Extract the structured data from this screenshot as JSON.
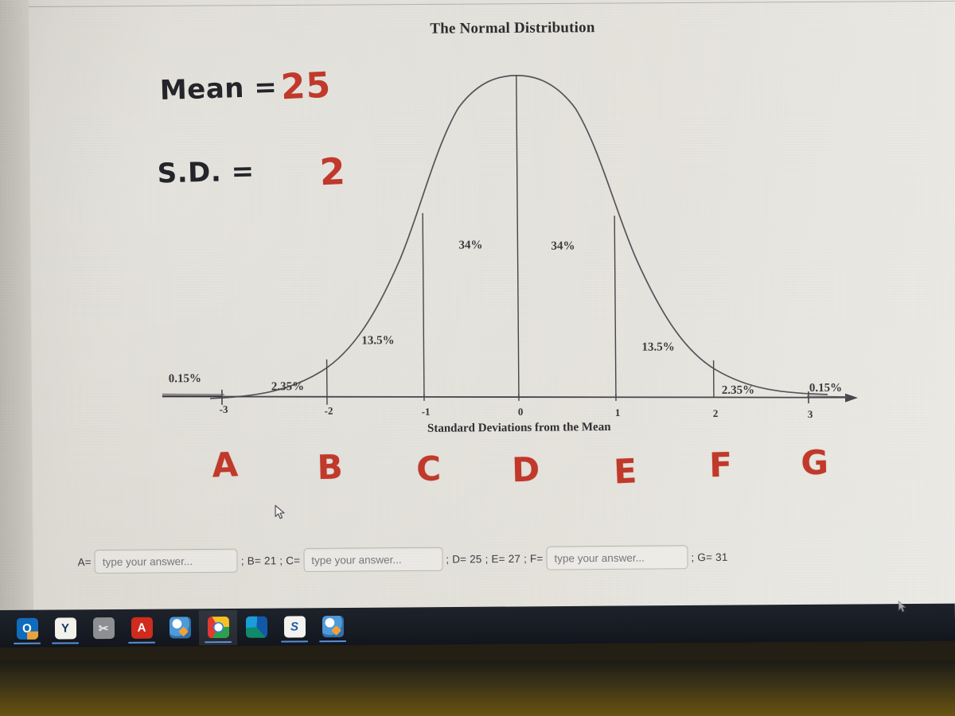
{
  "document": {
    "title": "The Normal Distribution"
  },
  "annotations": {
    "mean_label": "Mean =",
    "mean_value": "25",
    "sd_label": "S.D. =",
    "sd_value": "2",
    "ink_black": "#24252a",
    "ink_red": "#c0392b"
  },
  "chart_data": {
    "type": "area",
    "title": "The Normal Distribution",
    "xlabel": "Standard Deviations from the Mean",
    "ylabel": "",
    "xlim": [
      -3.5,
      3.5
    ],
    "grid": false,
    "legend": "none",
    "x_ticks": [
      "-3",
      "-2",
      "-1",
      "0",
      "1",
      "2",
      "3"
    ],
    "x_tick_values": [
      -3,
      -2,
      -1,
      0,
      1,
      2,
      3
    ],
    "region_labels": [
      "0.15%",
      "2.35%",
      "13.5%",
      "34%",
      "34%",
      "13.5%",
      "2.35%",
      "0.15%"
    ],
    "region_bounds": [
      [
        -3.5,
        -3
      ],
      [
        -3,
        -2
      ],
      [
        -2,
        -1
      ],
      [
        -1,
        0
      ],
      [
        0,
        1
      ],
      [
        1,
        2
      ],
      [
        2,
        3
      ],
      [
        3,
        3.5
      ]
    ],
    "region_values": [
      0.15,
      2.35,
      13.5,
      34,
      34,
      13.5,
      2.35,
      0.15
    ],
    "percent_labels": {
      "left_outer": "0.15%",
      "left_235": "2.35%",
      "left_135": "13.5%",
      "left_34": "34%",
      "right_34": "34%",
      "right_135": "13.5%",
      "right_235": "2.35%",
      "right_outer": "0.15%"
    },
    "curve": {
      "distribution": "normal",
      "mean": 0,
      "sd": 1,
      "mean_real": 25,
      "sd_real": 2
    }
  },
  "letters": {
    "items": [
      {
        "label": "A",
        "sd": -3
      },
      {
        "label": "B",
        "sd": -2
      },
      {
        "label": "C",
        "sd": -1
      },
      {
        "label": "D",
        "sd": 0
      },
      {
        "label": "E",
        "sd": 1
      },
      {
        "label": "F",
        "sd": 2
      },
      {
        "label": "G",
        "sd": 3
      }
    ]
  },
  "answers": {
    "a_label": "A=",
    "a_placeholder": "type your answer...",
    "a_value": "",
    "sep_b": "; B= 21 ; C=",
    "c_placeholder": "type your answer...",
    "c_value": "",
    "sep_d": "; D= 25 ; E= 27 ; F=",
    "f_placeholder": "type your answer...",
    "f_value": "",
    "sep_g": "; G= 31"
  },
  "taskbar": {
    "items": [
      {
        "name": "outlook",
        "glyph": "O",
        "active": false,
        "underline": true
      },
      {
        "name": "yammer",
        "glyph": "Y",
        "active": false,
        "underline": true
      },
      {
        "name": "snipping-tool",
        "glyph": "✂",
        "active": false,
        "underline": false
      },
      {
        "name": "acrobat-reader",
        "glyph": "A",
        "active": false,
        "underline": true
      },
      {
        "name": "browser-one",
        "glyph": "",
        "active": false,
        "underline": false
      },
      {
        "name": "google-chrome",
        "glyph": "",
        "active": true,
        "underline": true
      },
      {
        "name": "microsoft-edge",
        "glyph": "",
        "active": false,
        "underline": false
      },
      {
        "name": "s-app",
        "glyph": "S",
        "active": false,
        "underline": true
      },
      {
        "name": "browser-two",
        "glyph": "",
        "active": false,
        "underline": true
      }
    ]
  }
}
